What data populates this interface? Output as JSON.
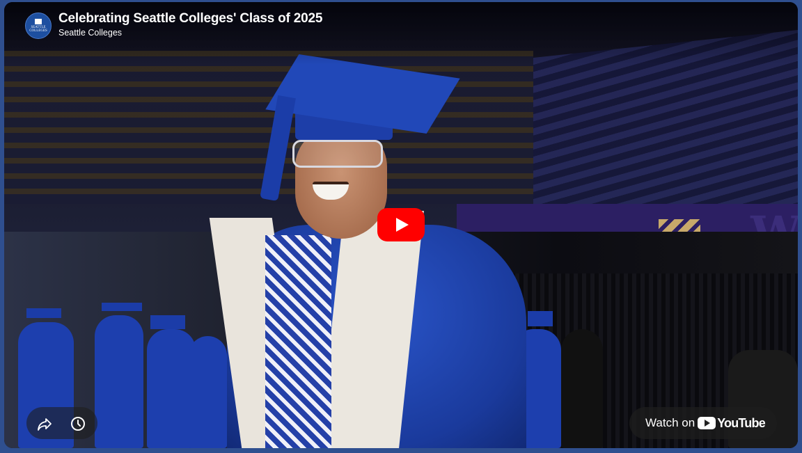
{
  "video": {
    "title": "Celebrating Seattle Colleges' Class of 2025",
    "channel": "Seattle Colleges",
    "avatar_text": "SEATTLE COLLEGES"
  },
  "controls": {
    "share_icon": "share-icon",
    "watch_later_icon": "clock-icon",
    "play_icon": "play-icon"
  },
  "watch_on": {
    "label": "Watch on",
    "brand": "YouTube"
  },
  "colors": {
    "play_red": "#ff0000",
    "frame_blue": "#2f4f8f"
  }
}
